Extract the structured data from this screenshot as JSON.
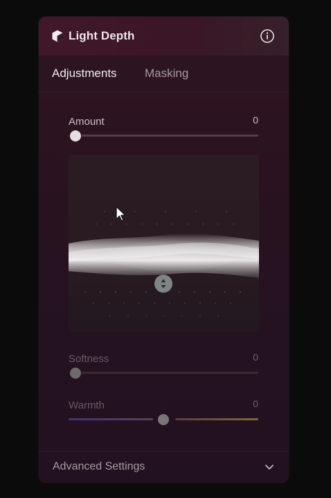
{
  "panel": {
    "title": "Light Depth",
    "info_icon": "info-circle-icon",
    "logo_icon": "light-depth-cube-icon"
  },
  "tabs": [
    {
      "label": "Adjustments",
      "active": true
    },
    {
      "label": "Masking",
      "active": false
    }
  ],
  "sliders": {
    "amount": {
      "label": "Amount",
      "value": "0",
      "level": 0
    },
    "softness": {
      "label": "Softness",
      "value": "0",
      "level": 0
    },
    "warmth": {
      "label": "Warmth",
      "value": "0",
      "level": 0.5
    }
  },
  "advanced": {
    "label": "Advanced Settings",
    "icon": "chevron-down-icon"
  },
  "colors": {
    "accent_warm": "#b59a4e",
    "accent_cool": "#4a3c8a",
    "panel_bg": "#261220"
  }
}
